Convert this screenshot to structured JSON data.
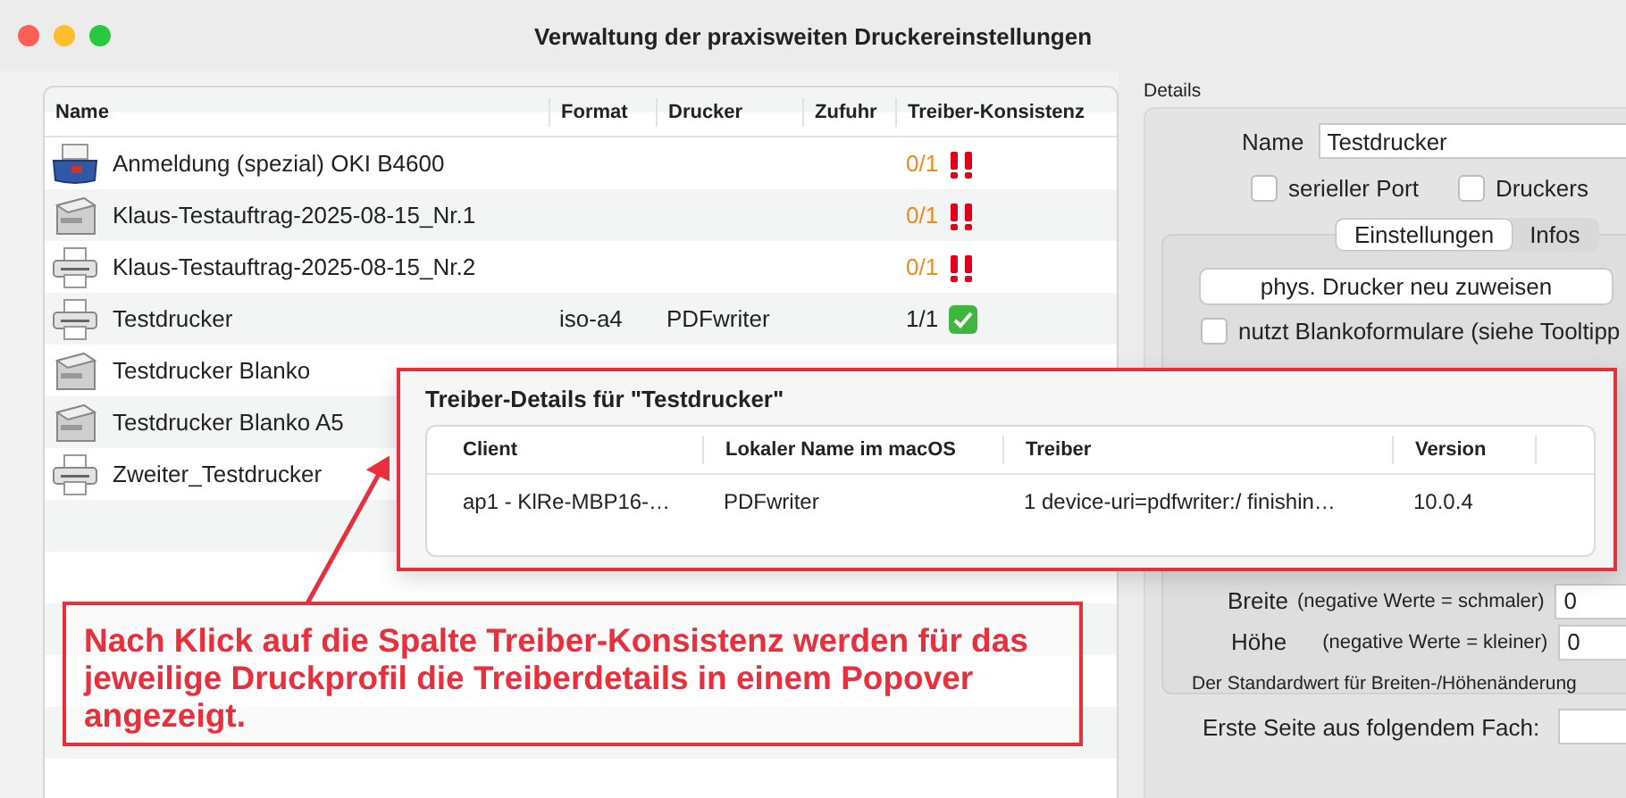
{
  "window": {
    "title": "Verwaltung der praxisweiten Druckereinstellungen"
  },
  "printers": {
    "columns": [
      "Name",
      "Format",
      "Drucker",
      "Zufuhr",
      "Treiber-Konsistenz"
    ],
    "rows": [
      {
        "kind": "dotmatrix",
        "name": "Anmeldung (spezial) OKI B4600",
        "consistency": "0/1",
        "consistent": false
      },
      {
        "kind": "laser",
        "name": "Klaus-Testauftrag-2025-08-15_Nr.1",
        "consistency": "0/1",
        "consistent": false
      },
      {
        "kind": "desk",
        "name": "Klaus-Testauftrag-2025-08-15_Nr.2",
        "consistency": "0/1",
        "consistent": false
      },
      {
        "kind": "desk",
        "name": "Testdrucker",
        "format": "iso-a4",
        "printer": "PDFwriter",
        "consistency": "1/1",
        "consistent": true
      },
      {
        "kind": "laser",
        "name": "Testdrucker Blanko"
      },
      {
        "kind": "laser",
        "name": "Testdrucker Blanko A5"
      },
      {
        "kind": "desk",
        "name": "Zweiter_Testdrucker"
      }
    ]
  },
  "details": {
    "label": "Details",
    "name_label": "Name",
    "name_value": "Testdrucker",
    "checkboxes": [
      {
        "label": "serieller Port",
        "checked": false
      },
      {
        "label": "Druckers",
        "checked": false
      }
    ],
    "tabs": [
      {
        "label": "Einstellungen",
        "selected": true
      },
      {
        "label": "Infos",
        "selected": false
      }
    ],
    "reassign_button": "phys. Drucker neu zuweisen",
    "blank_forms": {
      "label": "nutzt Blankoformulare (siehe Tooltipp",
      "checked": false
    },
    "size_fields": [
      {
        "label": "Breite",
        "hint": "(negative Werte = schmaler)",
        "value": "0"
      },
      {
        "label": "Höhe",
        "hint": "(negative Werte = kleiner)",
        "value": "0"
      }
    ],
    "note": "Der Standardwert für Breiten-/Höhenänderung",
    "first_page_label": "Erste Seite aus folgendem Fach:"
  },
  "popover": {
    "title": "Treiber-Details für \"Testdrucker\"",
    "columns": [
      "Client",
      "Lokaler Name im macOS",
      "Treiber",
      "Version"
    ],
    "rows": [
      {
        "client": "ap1 - KlRe-MBP16-…",
        "local_name": "PDFwriter",
        "driver": "1 device-uri=pdfwriter:/ finishin…",
        "version": "10.0.4"
      }
    ]
  },
  "annotation": {
    "text": "Nach Klick auf die Spalte Treiber-Konsistenz werden für das jeweilige Druckprofil die Treiberdetails in einem Popover angezeigt."
  }
}
